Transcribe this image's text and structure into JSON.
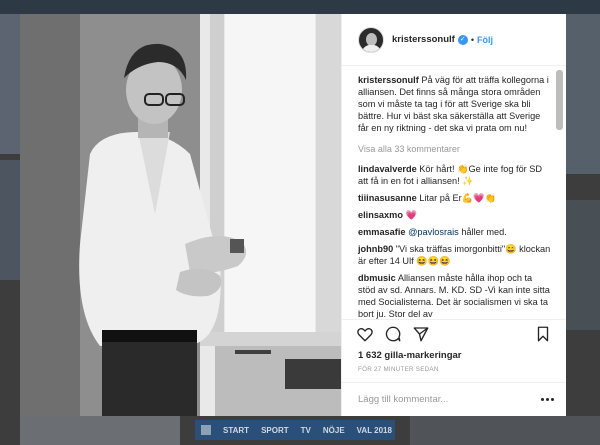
{
  "post": {
    "username": "kristerssonulf",
    "follow_label": "Följ",
    "separator": "•",
    "caption_user": "kristerssonulf",
    "caption_text": "På väg för att träffa kollegorna i alliansen. Det finns så många stora områden som vi måste ta tag i för att Sverige ska bli bättre. Hur vi bäst ska säkerställa att Sverige får en ny riktning - det ska vi prata om nu!",
    "view_all": "Visa alla 33 kommentarer",
    "likes": "1 632 gilla-markeringar",
    "time_ago": "FÖR 27 MINUTER SEDAN",
    "add_comment_placeholder": "Lägg till kommentar..."
  },
  "comments": [
    {
      "user": "lindavalverde",
      "text": "Kör hårt! 👏Ge inte fog för SD att få in en fot i alliansen! ✨"
    },
    {
      "user": "tiiinasusanne",
      "text": "Litar på Er💪💗👏"
    },
    {
      "user": "elinsaxmo",
      "text": "💗"
    },
    {
      "user": "emmasafie",
      "mention": "@pavlosrais",
      "text": " håller med."
    },
    {
      "user": "johnb90",
      "text": "\"Vi ska träffas imorgonbitti\"😄 klockan är efter 14 Ulf 😆😆😆"
    },
    {
      "user": "dbmusic",
      "text": "Alliansen måste hålla ihop och ta stöd av sd. Annars. M. KD. SD -Vi kan inte sitta med Socialisterna. Det är socialismen vi ska ta bort ju. Stor del av"
    }
  ],
  "background_nav": [
    "START",
    "SPORT",
    "TV",
    "NÖJE",
    "VAL 2018"
  ],
  "icons": {
    "like": "heart-icon",
    "comment": "comment-icon",
    "share": "share-icon",
    "save": "bookmark-icon",
    "verified": "verified-badge-icon",
    "options": "more-options-icon"
  },
  "colors": {
    "link": "#3897f0",
    "text": "#262626",
    "muted": "#999999"
  }
}
